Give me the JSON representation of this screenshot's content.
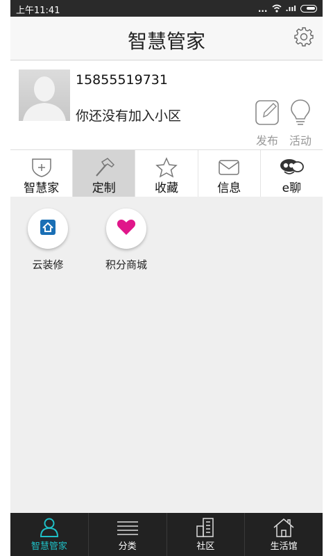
{
  "status_bar": {
    "time": "上午11:41",
    "dots": "...",
    "signal": ".ııl"
  },
  "header": {
    "title": "智慧管家"
  },
  "profile": {
    "phone": "15855519731",
    "community_status": "你还没有加入小区"
  },
  "actions": [
    {
      "label": "发布",
      "icon": "edit-icon"
    },
    {
      "label": "活动",
      "icon": "lightbulb-icon"
    }
  ],
  "tabs": [
    {
      "label": "智慧家",
      "icon": "shield-plus-icon"
    },
    {
      "label": "定制",
      "icon": "hammer-icon",
      "active": true
    },
    {
      "label": "收藏",
      "icon": "star-icon"
    },
    {
      "label": "信息",
      "icon": "envelope-icon"
    },
    {
      "label": "e聊",
      "icon": "chat-face-icon"
    }
  ],
  "features": [
    {
      "label": "云装修",
      "icon": "decoration-icon",
      "color": "#1a6fb5"
    },
    {
      "label": "积分商城",
      "icon": "heart-icon",
      "color": "#e0168a"
    }
  ],
  "bottom_nav": [
    {
      "label": "智慧管家",
      "icon": "person-icon",
      "active": true
    },
    {
      "label": "分类",
      "icon": "menu-lines-icon"
    },
    {
      "label": "社区",
      "icon": "building-icon"
    },
    {
      "label": "生活馆",
      "icon": "home-icon"
    }
  ],
  "colors": {
    "active_nav": "#1fc0c7",
    "status_bar": "#2a2a2a",
    "bottom_nav": "#222222",
    "active_tab": "#d4d4d4"
  }
}
